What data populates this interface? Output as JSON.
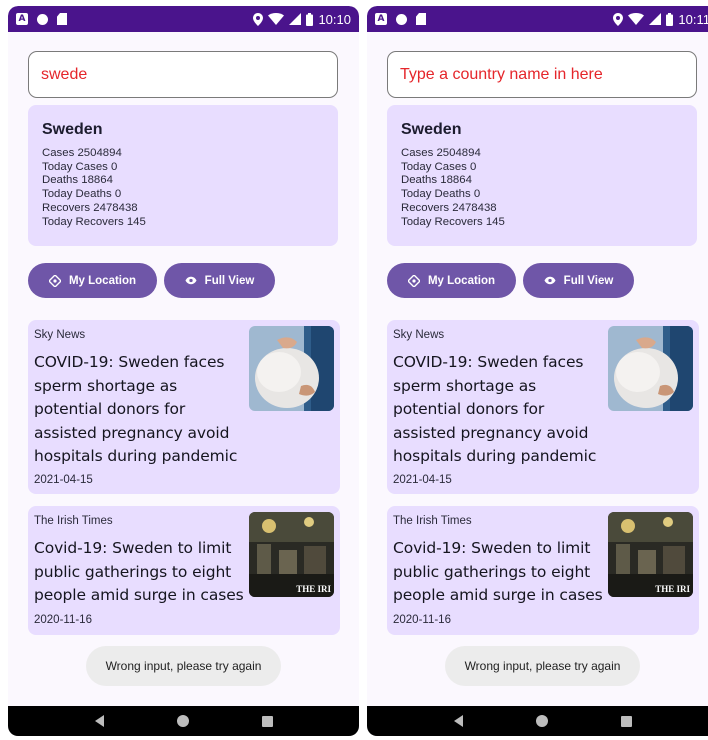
{
  "colors": {
    "status_bar": "#4a148c",
    "background": "#fbf8fe",
    "card": "#e8ddff",
    "button": "#6f56a8",
    "search_text": "#e5262b",
    "toast": "#ececec"
  },
  "icons": {
    "status_left": [
      "a-notification-icon",
      "circle-notification-icon",
      "sd-card-icon"
    ],
    "status_right": [
      "location-icon",
      "wifi-icon",
      "signal-icon",
      "battery-icon"
    ],
    "buttons": [
      "location-diamond-icon",
      "eye-icon"
    ],
    "nav": [
      "back-icon",
      "home-icon",
      "recents-icon"
    ]
  },
  "screens": [
    {
      "status": {
        "time": "10:10"
      },
      "search": {
        "value": "swede"
      },
      "stats": {
        "country": "Sweden",
        "lines": [
          "Cases 2504894",
          "Today Cases 0",
          "Deaths 18864",
          "Today Deaths 0",
          "Recovers 2478438",
          "Today Recovers  145"
        ]
      },
      "buttons": {
        "location": "My Location",
        "view": "Full View"
      },
      "news": [
        {
          "source": "Sky News",
          "title": "COVID-19: Sweden faces sperm shortage as potential donors for assisted pregnancy avoid hospitals during pandemic",
          "date": "2021-04-15"
        },
        {
          "source": "The Irish Times",
          "title": "Covid-19: Sweden to limit public gatherings to eight people amid surge in cases",
          "date": "2020-11-16",
          "thumb_caption": "THE IRI"
        }
      ],
      "toast": "Wrong input, please try again"
    },
    {
      "status": {
        "time": "10:11"
      },
      "search": {
        "value": "Type a country name in here"
      },
      "stats": {
        "country": "Sweden",
        "lines": [
          "Cases 2504894",
          "Today Cases 0",
          "Deaths 18864",
          "Today Deaths 0",
          "Recovers 2478438",
          "Today Recovers  145"
        ]
      },
      "buttons": {
        "location": "My Location",
        "view": "Full View"
      },
      "news": [
        {
          "source": "Sky News",
          "title": "COVID-19: Sweden faces sperm shortage as potential donors for assisted pregnancy avoid hospitals during pandemic",
          "date": "2021-04-15"
        },
        {
          "source": "The Irish Times",
          "title": "Covid-19: Sweden to limit public gatherings to eight people amid surge in cases",
          "date": "2020-11-16",
          "thumb_caption": "THE IRI"
        }
      ],
      "toast": "Wrong input, please try again"
    }
  ]
}
